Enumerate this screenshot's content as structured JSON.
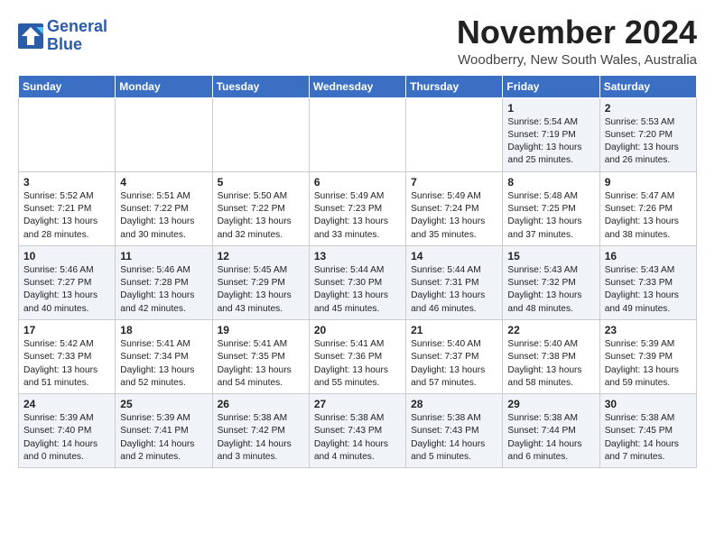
{
  "header": {
    "logo_line1": "General",
    "logo_line2": "Blue",
    "month": "November 2024",
    "location": "Woodberry, New South Wales, Australia"
  },
  "columns": [
    "Sunday",
    "Monday",
    "Tuesday",
    "Wednesday",
    "Thursday",
    "Friday",
    "Saturday"
  ],
  "weeks": [
    [
      {
        "day": "",
        "text": ""
      },
      {
        "day": "",
        "text": ""
      },
      {
        "day": "",
        "text": ""
      },
      {
        "day": "",
        "text": ""
      },
      {
        "day": "",
        "text": ""
      },
      {
        "day": "1",
        "text": "Sunrise: 5:54 AM\nSunset: 7:19 PM\nDaylight: 13 hours\nand 25 minutes."
      },
      {
        "day": "2",
        "text": "Sunrise: 5:53 AM\nSunset: 7:20 PM\nDaylight: 13 hours\nand 26 minutes."
      }
    ],
    [
      {
        "day": "3",
        "text": "Sunrise: 5:52 AM\nSunset: 7:21 PM\nDaylight: 13 hours\nand 28 minutes."
      },
      {
        "day": "4",
        "text": "Sunrise: 5:51 AM\nSunset: 7:22 PM\nDaylight: 13 hours\nand 30 minutes."
      },
      {
        "day": "5",
        "text": "Sunrise: 5:50 AM\nSunset: 7:22 PM\nDaylight: 13 hours\nand 32 minutes."
      },
      {
        "day": "6",
        "text": "Sunrise: 5:49 AM\nSunset: 7:23 PM\nDaylight: 13 hours\nand 33 minutes."
      },
      {
        "day": "7",
        "text": "Sunrise: 5:49 AM\nSunset: 7:24 PM\nDaylight: 13 hours\nand 35 minutes."
      },
      {
        "day": "8",
        "text": "Sunrise: 5:48 AM\nSunset: 7:25 PM\nDaylight: 13 hours\nand 37 minutes."
      },
      {
        "day": "9",
        "text": "Sunrise: 5:47 AM\nSunset: 7:26 PM\nDaylight: 13 hours\nand 38 minutes."
      }
    ],
    [
      {
        "day": "10",
        "text": "Sunrise: 5:46 AM\nSunset: 7:27 PM\nDaylight: 13 hours\nand 40 minutes."
      },
      {
        "day": "11",
        "text": "Sunrise: 5:46 AM\nSunset: 7:28 PM\nDaylight: 13 hours\nand 42 minutes."
      },
      {
        "day": "12",
        "text": "Sunrise: 5:45 AM\nSunset: 7:29 PM\nDaylight: 13 hours\nand 43 minutes."
      },
      {
        "day": "13",
        "text": "Sunrise: 5:44 AM\nSunset: 7:30 PM\nDaylight: 13 hours\nand 45 minutes."
      },
      {
        "day": "14",
        "text": "Sunrise: 5:44 AM\nSunset: 7:31 PM\nDaylight: 13 hours\nand 46 minutes."
      },
      {
        "day": "15",
        "text": "Sunrise: 5:43 AM\nSunset: 7:32 PM\nDaylight: 13 hours\nand 48 minutes."
      },
      {
        "day": "16",
        "text": "Sunrise: 5:43 AM\nSunset: 7:33 PM\nDaylight: 13 hours\nand 49 minutes."
      }
    ],
    [
      {
        "day": "17",
        "text": "Sunrise: 5:42 AM\nSunset: 7:33 PM\nDaylight: 13 hours\nand 51 minutes."
      },
      {
        "day": "18",
        "text": "Sunrise: 5:41 AM\nSunset: 7:34 PM\nDaylight: 13 hours\nand 52 minutes."
      },
      {
        "day": "19",
        "text": "Sunrise: 5:41 AM\nSunset: 7:35 PM\nDaylight: 13 hours\nand 54 minutes."
      },
      {
        "day": "20",
        "text": "Sunrise: 5:41 AM\nSunset: 7:36 PM\nDaylight: 13 hours\nand 55 minutes."
      },
      {
        "day": "21",
        "text": "Sunrise: 5:40 AM\nSunset: 7:37 PM\nDaylight: 13 hours\nand 57 minutes."
      },
      {
        "day": "22",
        "text": "Sunrise: 5:40 AM\nSunset: 7:38 PM\nDaylight: 13 hours\nand 58 minutes."
      },
      {
        "day": "23",
        "text": "Sunrise: 5:39 AM\nSunset: 7:39 PM\nDaylight: 13 hours\nand 59 minutes."
      }
    ],
    [
      {
        "day": "24",
        "text": "Sunrise: 5:39 AM\nSunset: 7:40 PM\nDaylight: 14 hours\nand 0 minutes."
      },
      {
        "day": "25",
        "text": "Sunrise: 5:39 AM\nSunset: 7:41 PM\nDaylight: 14 hours\nand 2 minutes."
      },
      {
        "day": "26",
        "text": "Sunrise: 5:38 AM\nSunset: 7:42 PM\nDaylight: 14 hours\nand 3 minutes."
      },
      {
        "day": "27",
        "text": "Sunrise: 5:38 AM\nSunset: 7:43 PM\nDaylight: 14 hours\nand 4 minutes."
      },
      {
        "day": "28",
        "text": "Sunrise: 5:38 AM\nSunset: 7:43 PM\nDaylight: 14 hours\nand 5 minutes."
      },
      {
        "day": "29",
        "text": "Sunrise: 5:38 AM\nSunset: 7:44 PM\nDaylight: 14 hours\nand 6 minutes."
      },
      {
        "day": "30",
        "text": "Sunrise: 5:38 AM\nSunset: 7:45 PM\nDaylight: 14 hours\nand 7 minutes."
      }
    ]
  ]
}
